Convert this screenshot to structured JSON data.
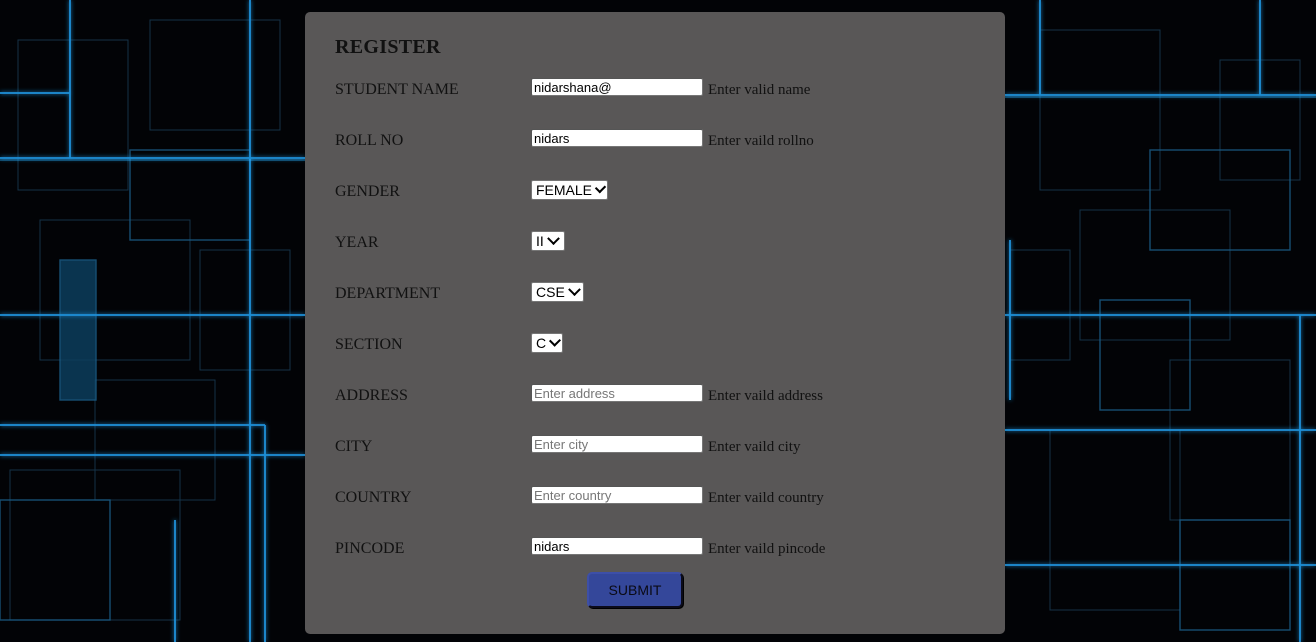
{
  "colors": {
    "panel": "#5c5a5a",
    "accent_line": "#1e90d8",
    "submit_button": "#34479a"
  },
  "form": {
    "title": "REGISTER",
    "fields": {
      "student_name": {
        "label": "STUDENT NAME",
        "value": "nidarshana@",
        "placeholder": "",
        "hint": "Enter valid name"
      },
      "roll_no": {
        "label": "ROLL NO",
        "value": "nidars",
        "placeholder": "",
        "hint": "Enter vaild rollno"
      },
      "gender": {
        "label": "GENDER",
        "selected": "FEMALE"
      },
      "year": {
        "label": "YEAR",
        "selected": "II"
      },
      "department": {
        "label": "DEPARTMENT",
        "selected": "CSE"
      },
      "section": {
        "label": "SECTION",
        "selected": "C"
      },
      "address": {
        "label": "ADDRESS",
        "value": "",
        "placeholder": "Enter address",
        "hint": "Enter vaild address"
      },
      "city": {
        "label": "CITY",
        "value": "",
        "placeholder": "Enter city",
        "hint": "Enter vaild city"
      },
      "country": {
        "label": "COUNTRY",
        "value": "",
        "placeholder": "Enter country",
        "hint": "Enter vaild country"
      },
      "pincode": {
        "label": "PINCODE",
        "value": "nidars",
        "placeholder": "",
        "hint": "Enter vaild pincode"
      }
    },
    "submit_label": "SUBMIT"
  }
}
